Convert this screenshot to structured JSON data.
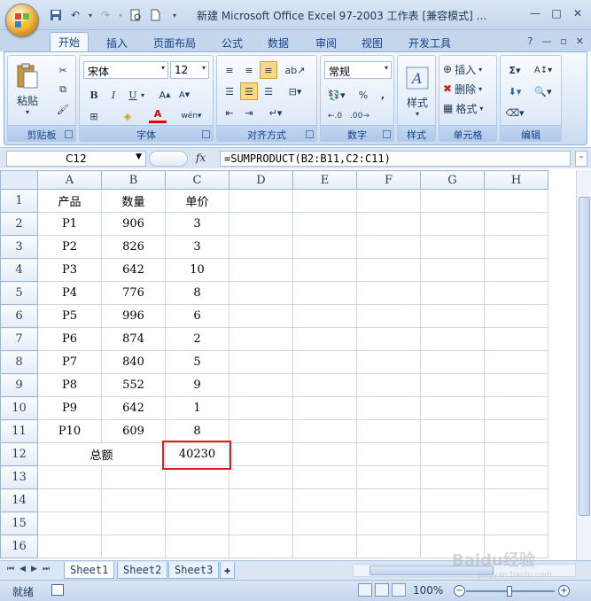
{
  "window": {
    "title": "新建 Microsoft Office Excel 97-2003 工作表 [兼容模式] ..."
  },
  "tabs": [
    "开始",
    "插入",
    "页面布局",
    "公式",
    "数据",
    "审阅",
    "视图",
    "开发工具"
  ],
  "ribbon": {
    "clipboard": {
      "label": "剪贴板",
      "paste": "粘贴"
    },
    "font": {
      "label": "字体",
      "name": "宋体",
      "size": "12"
    },
    "alignment": {
      "label": "对齐方式"
    },
    "number": {
      "label": "数字",
      "format": "常规"
    },
    "styles": {
      "label": "样式"
    },
    "cells": {
      "label": "单元格",
      "insert": "插入",
      "delete": "删除",
      "format": "格式"
    },
    "editing": {
      "label": "编辑"
    }
  },
  "formula_bar": {
    "name_box": "C12",
    "fx": "fx",
    "formula": "=SUMPRODUCT(B2:B11,C2:C11)"
  },
  "columns": [
    "A",
    "B",
    "C",
    "D",
    "E",
    "F",
    "G",
    "H"
  ],
  "rows": [
    {
      "n": "1",
      "a": "产品",
      "b": "数量",
      "c": "单价"
    },
    {
      "n": "2",
      "a": "P1",
      "b": "906",
      "c": "3"
    },
    {
      "n": "3",
      "a": "P2",
      "b": "826",
      "c": "3"
    },
    {
      "n": "4",
      "a": "P3",
      "b": "642",
      "c": "10"
    },
    {
      "n": "5",
      "a": "P4",
      "b": "776",
      "c": "8"
    },
    {
      "n": "6",
      "a": "P5",
      "b": "996",
      "c": "6"
    },
    {
      "n": "7",
      "a": "P6",
      "b": "874",
      "c": "2"
    },
    {
      "n": "8",
      "a": "P7",
      "b": "840",
      "c": "5"
    },
    {
      "n": "9",
      "a": "P8",
      "b": "552",
      "c": "9"
    },
    {
      "n": "10",
      "a": "P9",
      "b": "642",
      "c": "1"
    },
    {
      "n": "11",
      "a": "P10",
      "b": "609",
      "c": "8"
    },
    {
      "n": "12",
      "ab": "总额",
      "c": "40230"
    },
    {
      "n": "13"
    },
    {
      "n": "14"
    },
    {
      "n": "15"
    },
    {
      "n": "16"
    }
  ],
  "sheets": [
    "Sheet1",
    "Sheet2",
    "Sheet3"
  ],
  "status": {
    "ready": "就绪",
    "zoom": "100%"
  },
  "watermark": {
    "text": "Baidu经验",
    "sub": "jingyan.baidu.com"
  }
}
